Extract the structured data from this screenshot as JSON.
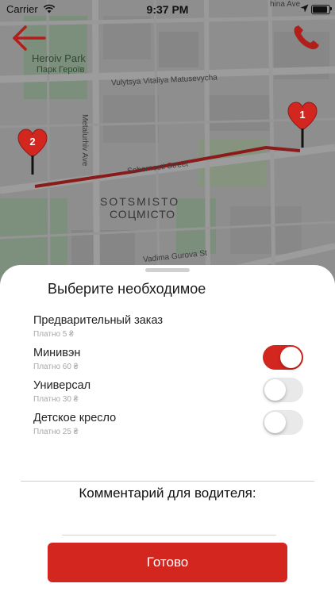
{
  "status_bar": {
    "carrier": "Carrier",
    "time": "9:37 PM"
  },
  "map": {
    "park_name_en": "Heroiv Park",
    "park_name_uk": "Парк Героїв",
    "street_vitaliya": "Vulytsya Vitaliya Matusevycha",
    "street_metalurhiv": "Metalurhiv Ave",
    "street_soborniosti": "Sobornosti Street",
    "street_vadima": "Vadima Gurova St",
    "street_top": "hina Ave",
    "district_en": "SOTSMISTO",
    "district_uk": "СОЦМІСТО",
    "pins": [
      {
        "number": "1"
      },
      {
        "number": "2"
      }
    ],
    "route_color": "#8b1b1b"
  },
  "sheet": {
    "title": "Выберите необходимое",
    "options": [
      {
        "title": "Предварительный заказ",
        "price": "Платно 5 ₴",
        "has_toggle": false
      },
      {
        "title": "Минивэн",
        "price": "Платно 60 ₴",
        "has_toggle": true,
        "enabled": true
      },
      {
        "title": "Универсал",
        "price": "Платно 30 ₴",
        "has_toggle": true,
        "enabled": false
      },
      {
        "title": "Детское кресло",
        "price": "Платно 25 ₴",
        "has_toggle": true,
        "enabled": false
      }
    ],
    "comment_label": "Комментарий для водителя:",
    "comment_value": "",
    "done_label": "Готово"
  },
  "colors": {
    "accent": "#d3261f",
    "toggle_off": "#e9e9ea"
  },
  "icons": {
    "back": "arrow-left-icon",
    "call": "phone-icon",
    "pin": "heart-pin-icon"
  }
}
